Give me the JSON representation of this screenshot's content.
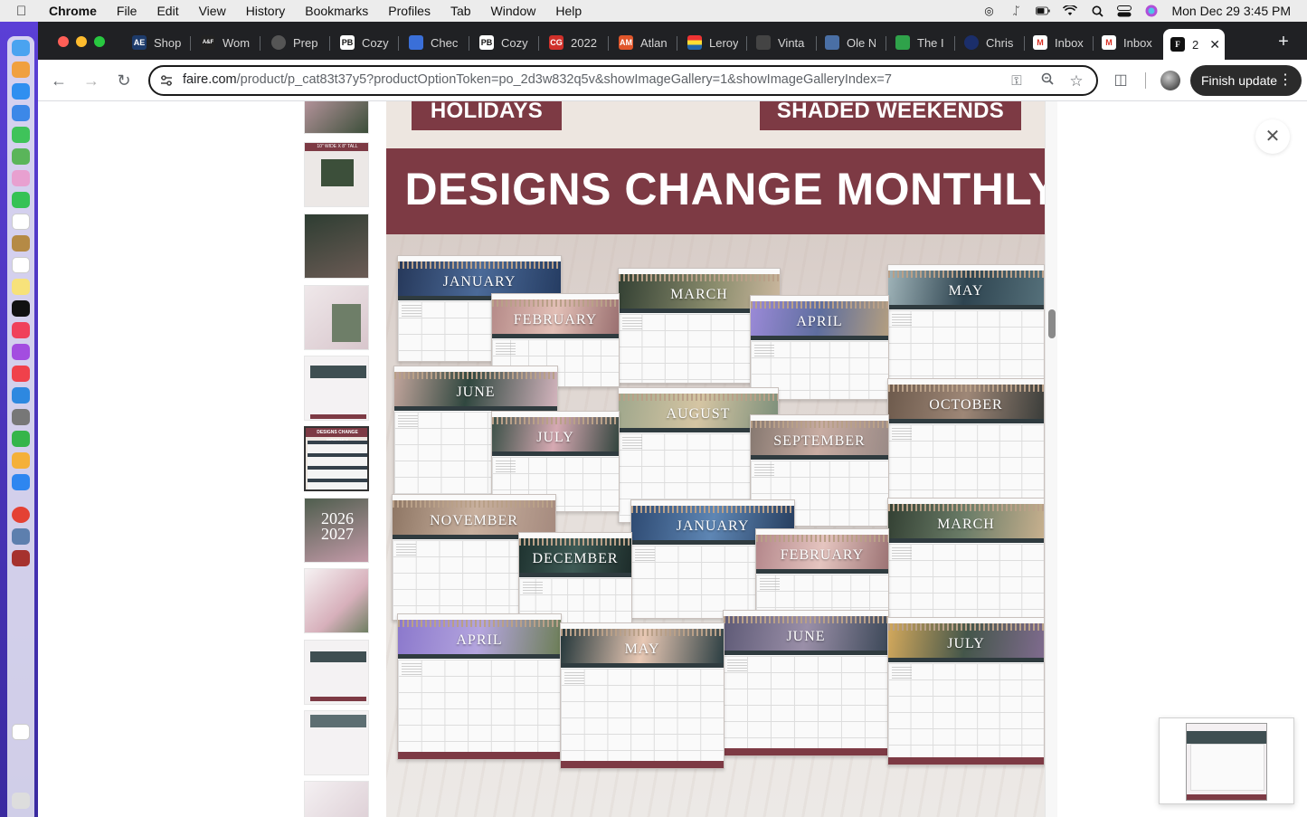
{
  "menubar": {
    "app": "Chrome",
    "items": [
      "File",
      "Edit",
      "View",
      "History",
      "Bookmarks",
      "Profiles",
      "Tab",
      "Window",
      "Help"
    ],
    "clock": "Mon Dec 29  3:45 PM"
  },
  "tabs": [
    {
      "label": "Shop",
      "favicon": "AE",
      "color": "#1d3b6b"
    },
    {
      "label": "Wom",
      "favicon": "A&F",
      "color": "#222222"
    },
    {
      "label": "Prep",
      "favicon": "",
      "color": "#555555"
    },
    {
      "label": "Cozy",
      "favicon": "PB",
      "color": "#111111"
    },
    {
      "label": "Chec",
      "favicon": "",
      "color": "#3a6fd8"
    },
    {
      "label": "Cozy",
      "favicon": "PB",
      "color": "#111111"
    },
    {
      "label": "2022",
      "favicon": "CG",
      "color": "#d0302a"
    },
    {
      "label": "Atlan",
      "favicon": "AM",
      "color": "#e0562b"
    },
    {
      "label": "Leroy",
      "favicon": "",
      "color": "#2255aa"
    },
    {
      "label": "Vinta",
      "favicon": "",
      "color": "#444444"
    },
    {
      "label": "Ole N",
      "favicon": "",
      "color": "#4a6fa5"
    },
    {
      "label": "The I",
      "favicon": "",
      "color": "#2fa24a"
    },
    {
      "label": "Chris",
      "favicon": "",
      "color": "#1b2e6a"
    },
    {
      "label": "Inbox",
      "favicon": "M",
      "color": "#d93025"
    },
    {
      "label": "Inbox",
      "favicon": "M",
      "color": "#d93025"
    }
  ],
  "active_tab": {
    "label": "2",
    "favicon": "F"
  },
  "toolbar": {
    "url_host": "faire.com",
    "url_path": "/product/p_cat83t37y5?productOptionToken=po_2d3w832q5v&showImageGallery=1&showImageGalleryIndex=7",
    "finish_update": "Finish update"
  },
  "gallery": {
    "pill_left": "HOLIDAYS",
    "pill_right": "SHADED WEEKENDS",
    "banner": "DESIGNS CHANGE MONTHLY",
    "months": [
      "JANUARY",
      "FEBRUARY",
      "MARCH",
      "APRIL",
      "MAY",
      "JUNE",
      "JULY",
      "AUGUST",
      "SEPTEMBER",
      "OCTOBER",
      "NOVEMBER",
      "DECEMBER",
      "JANUARY",
      "FEBRUARY",
      "MARCH",
      "APRIL",
      "MAY",
      "JUNE",
      "JULY"
    ],
    "thumb_labels": {
      "t2": "10\" WIDE X 8\" TALL",
      "t7": "DESIGNS CHANGE MONTHLY",
      "t8": "2026 2027"
    }
  },
  "colors": {
    "brand": "#7d3a44",
    "dark_head": "#2f3b3f"
  }
}
